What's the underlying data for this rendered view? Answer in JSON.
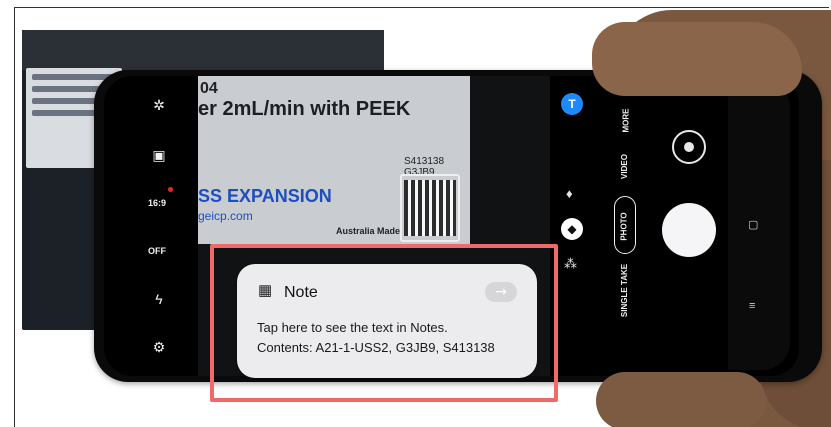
{
  "document": {
    "line1": "er 2mL/min with PEEK",
    "tag": "04",
    "company": "SS EXPANSION",
    "website": "geicp.com",
    "codes": [
      "S413138",
      "G3JB9"
    ],
    "made": "Australia Made"
  },
  "camera": {
    "filter_badge": "T",
    "aspect_label": "16:9",
    "timer_label": "OFF",
    "modes": [
      "SINGLE TAKE",
      "PHOTO",
      "VIDEO",
      "MORE"
    ],
    "selected_mode": "PHOTO"
  },
  "note_popup": {
    "title": "Note",
    "line1": "Tap here to see the text in Notes.",
    "line2": "Contents: A21-1-USS2, G3JB9, S413138"
  },
  "colors": {
    "highlight": "#f06a6a",
    "badge": "#1e88ff",
    "popup": "#ececee"
  }
}
